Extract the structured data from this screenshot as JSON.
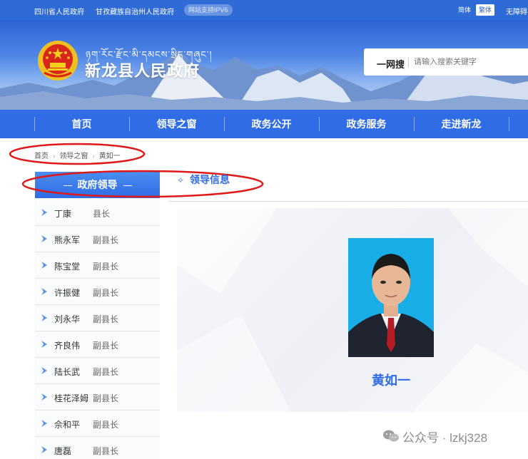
{
  "topbar": {
    "link1": "四川省人民政府",
    "link2": "甘孜藏族自治州人民政府",
    "ipv6": "网站支持IPV6",
    "lang_simplified": "简体",
    "lang_traditional": "繁体",
    "accessibility": "无障碍"
  },
  "header": {
    "tibetan": "ཉག་རོང་རྫོང་མི་དམངས་སྲིད་གཞུང་།",
    "site_title": "新龙县人民政府",
    "search_label": "一网搜",
    "search_placeholder": "请输入搜索关键字"
  },
  "nav": {
    "items": [
      "首页",
      "领导之窗",
      "政务公开",
      "政务服务",
      "走进新龙"
    ]
  },
  "breadcrumb": [
    "首页",
    "领导之窗",
    "黄如一"
  ],
  "sidebar": {
    "heading": "政府领导",
    "items": [
      {
        "name": "丁康",
        "title": "县长"
      },
      {
        "name": "熊永军",
        "title": "副县长"
      },
      {
        "name": "陈宝堂",
        "title": "副县长"
      },
      {
        "name": "许振健",
        "title": "副县长"
      },
      {
        "name": "刘永华",
        "title": "副县长"
      },
      {
        "name": "齐良伟",
        "title": "副县长"
      },
      {
        "name": "陆长武",
        "title": "副县长"
      },
      {
        "name": "桂花泽姆",
        "title": "副县长"
      },
      {
        "name": "佘和平",
        "title": "副县长"
      },
      {
        "name": "唐磊",
        "title": "副县长"
      }
    ]
  },
  "main": {
    "heading": "领导信息",
    "leader_name": "黄如一"
  },
  "watermark": {
    "text": "公众号 · lzkj328"
  },
  "colors": {
    "primary": "#2f6ce5",
    "annotation_red": "#e01818"
  }
}
